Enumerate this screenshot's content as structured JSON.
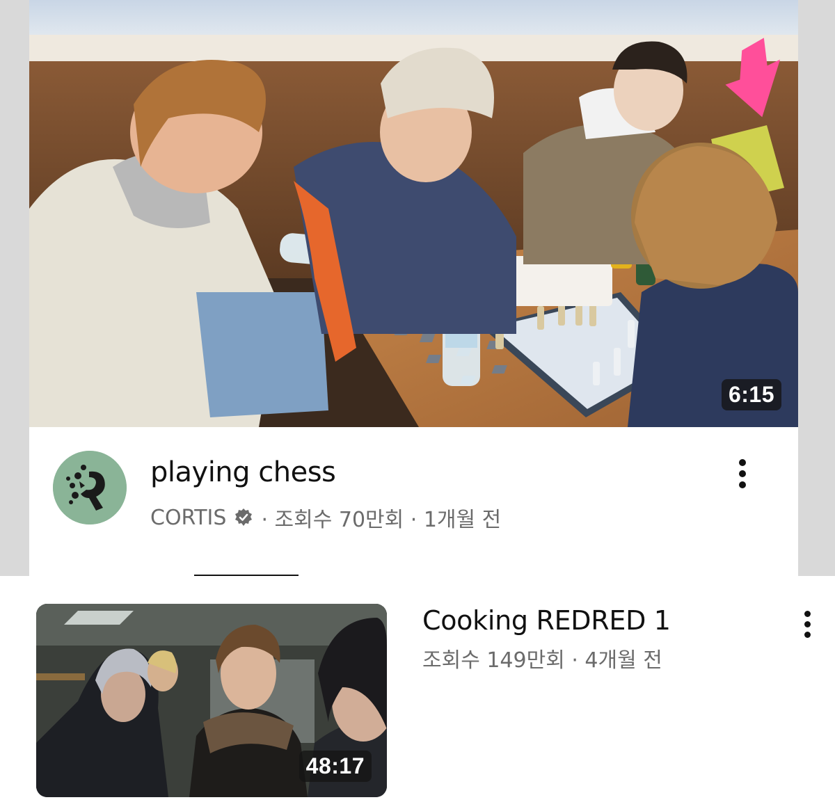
{
  "featured": {
    "title": "playing chess",
    "channel": "CORTIS",
    "stats": "· 조회수 70만회 · 1개월 전",
    "duration": "6:15",
    "avatar_icon": "cortis-logo-icon",
    "verified_icon": "verified-badge-icon"
  },
  "list": [
    {
      "title": "Cooking REDRED 1",
      "stats": "조회수 149만회 · 4개월 전",
      "duration": "48:17"
    }
  ],
  "colors": {
    "avatar_bg": "#8ab497",
    "arrow": "#ff4f9a",
    "secondary_text": "#6b6b6b"
  }
}
